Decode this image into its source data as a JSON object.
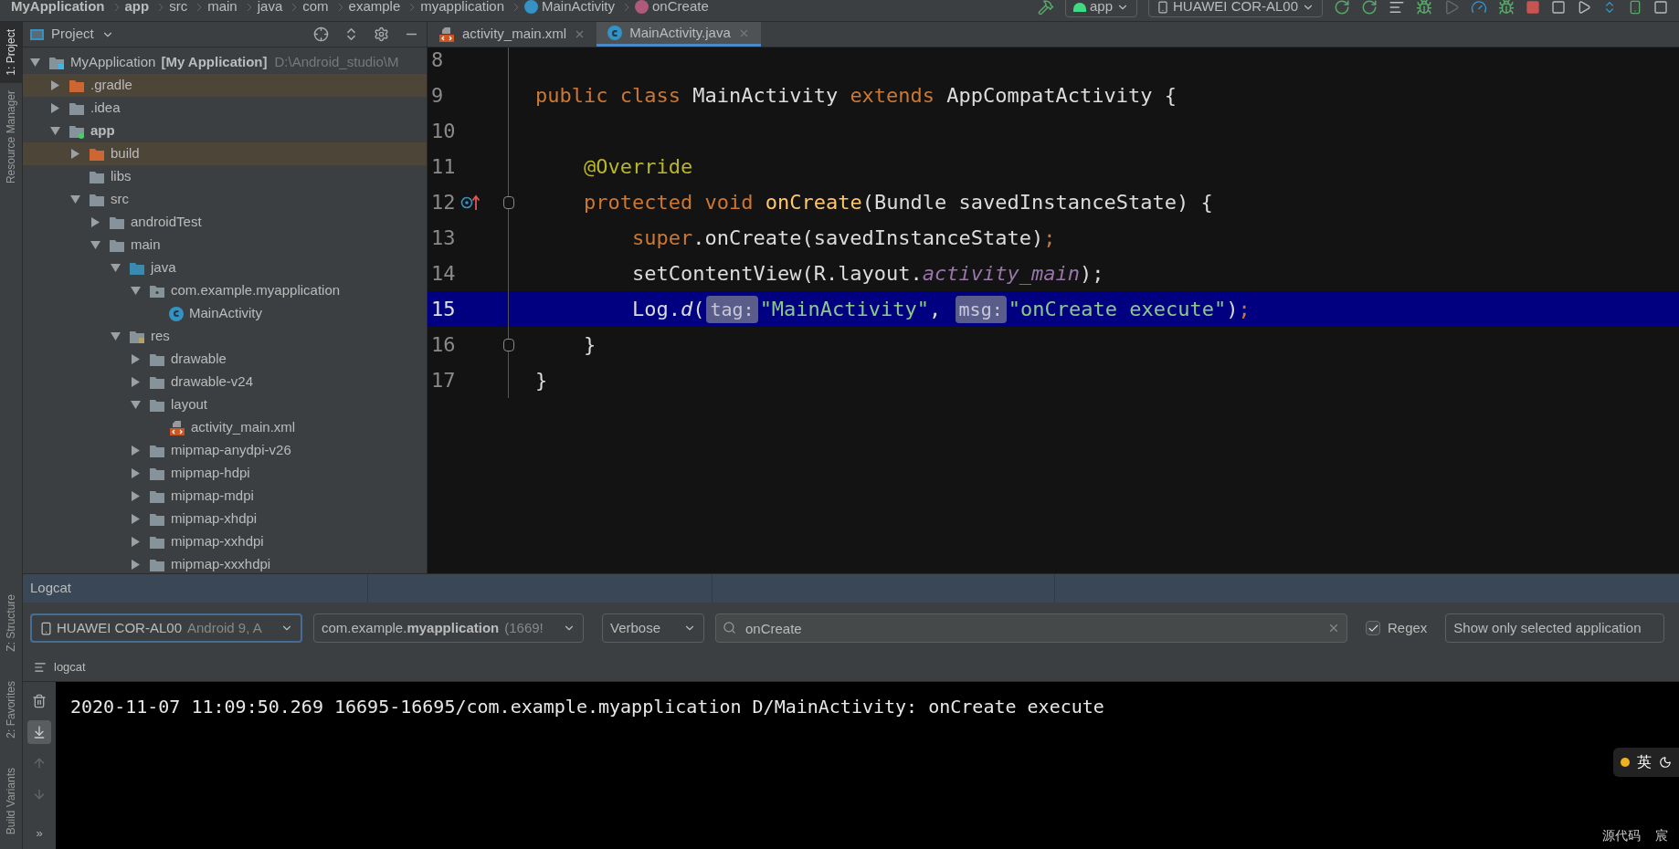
{
  "breadcrumbs": [
    {
      "label": "MyApplication",
      "kind": "project"
    },
    {
      "label": "app",
      "kind": "module"
    },
    {
      "label": "src",
      "kind": "dir"
    },
    {
      "label": "main",
      "kind": "dir"
    },
    {
      "label": "java",
      "kind": "dir"
    },
    {
      "label": "com",
      "kind": "dir"
    },
    {
      "label": "example",
      "kind": "dir"
    },
    {
      "label": "myapplication",
      "kind": "dir"
    },
    {
      "label": "MainActivity",
      "kind": "class"
    },
    {
      "label": "onCreate",
      "kind": "method"
    }
  ],
  "toolbar": {
    "run_config": "app",
    "device": "HUAWEI COR-AL00"
  },
  "side_tools_top": [
    {
      "label": "1: Project",
      "selected": true
    },
    {
      "label": "Resource Manager",
      "selected": false
    }
  ],
  "side_tools_bottom": [
    {
      "label": "Z: Structure",
      "selected": false
    },
    {
      "label": "2: Favorites",
      "selected": false
    },
    {
      "label": "Build Variants",
      "selected": false
    }
  ],
  "project_panel": {
    "title": "Project",
    "tree": [
      {
        "name": "MyApplication",
        "module_label": "[My Application]",
        "path": "D:\\Android_studio\\M",
        "kind": "project",
        "expanded": true,
        "children": [
          {
            "name": ".gradle",
            "kind": "excluded",
            "expanded": false
          },
          {
            "name": ".idea",
            "kind": "folder",
            "expanded": false
          },
          {
            "name": "app",
            "kind": "module",
            "expanded": true,
            "children": [
              {
                "name": "build",
                "kind": "excluded",
                "expanded": false
              },
              {
                "name": "libs",
                "kind": "folder"
              },
              {
                "name": "src",
                "kind": "folder",
                "expanded": true,
                "children": [
                  {
                    "name": "androidTest",
                    "kind": "folder",
                    "expanded": false
                  },
                  {
                    "name": "main",
                    "kind": "folder",
                    "expanded": true,
                    "children": [
                      {
                        "name": "java",
                        "kind": "source",
                        "expanded": true,
                        "children": [
                          {
                            "name": "com.example.myapplication",
                            "kind": "package",
                            "expanded": true,
                            "children": [
                              {
                                "name": "MainActivity",
                                "kind": "class"
                              }
                            ]
                          }
                        ]
                      },
                      {
                        "name": "res",
                        "kind": "resources",
                        "expanded": true,
                        "children": [
                          {
                            "name": "drawable",
                            "kind": "folder",
                            "expanded": false
                          },
                          {
                            "name": "drawable-v24",
                            "kind": "folder",
                            "expanded": false
                          },
                          {
                            "name": "layout",
                            "kind": "folder",
                            "expanded": true,
                            "children": [
                              {
                                "name": "activity_main.xml",
                                "kind": "xml"
                              }
                            ]
                          },
                          {
                            "name": "mipmap-anydpi-v26",
                            "kind": "folder",
                            "expanded": false
                          },
                          {
                            "name": "mipmap-hdpi",
                            "kind": "folder",
                            "expanded": false
                          },
                          {
                            "name": "mipmap-mdpi",
                            "kind": "folder",
                            "expanded": false
                          },
                          {
                            "name": "mipmap-xhdpi",
                            "kind": "folder",
                            "expanded": false
                          },
                          {
                            "name": "mipmap-xxhdpi",
                            "kind": "folder",
                            "expanded": false
                          },
                          {
                            "name": "mipmap-xxxhdpi",
                            "kind": "folder",
                            "expanded": false
                          }
                        ]
                      }
                    ]
                  }
                ]
              }
            ]
          }
        ]
      }
    ]
  },
  "editor": {
    "tabs": [
      {
        "label": "activity_main.xml",
        "kind": "xml",
        "selected": false
      },
      {
        "label": "MainActivity.java",
        "kind": "class",
        "selected": true
      }
    ],
    "lines": [
      {
        "number": "8",
        "highlighted": false
      },
      {
        "number": "9",
        "highlighted": false,
        "tokens": [
          {
            "text": "public class ",
            "kind": "keyword"
          },
          {
            "text": "MainActivity ",
            "kind": "plain"
          },
          {
            "text": "extends ",
            "kind": "keyword"
          },
          {
            "text": "AppCompatActivity {",
            "kind": "plain"
          }
        ]
      },
      {
        "number": "10",
        "highlighted": false
      },
      {
        "number": "11",
        "highlighted": false,
        "tokens": [
          {
            "text": "    @Override",
            "kind": "annotation"
          }
        ]
      },
      {
        "number": "12",
        "highlighted": false,
        "override_marker": true,
        "fold": true,
        "tokens": [
          {
            "text": "    protected void ",
            "kind": "keyword"
          },
          {
            "text": "onCreate",
            "kind": "method"
          },
          {
            "text": "(Bundle savedInstanceState) {",
            "kind": "plain"
          }
        ]
      },
      {
        "number": "13",
        "highlighted": false,
        "tokens": [
          {
            "text": "        super",
            "kind": "keyword"
          },
          {
            "text": ".onCreate(savedInstanceState)",
            "kind": "plain"
          },
          {
            "text": ";",
            "kind": "keyword"
          }
        ]
      },
      {
        "number": "14",
        "highlighted": false,
        "tokens": [
          {
            "text": "        setContentView(R.layout.",
            "kind": "plain"
          },
          {
            "text": "activity_main",
            "kind": "field"
          },
          {
            "text": ");",
            "kind": "plain"
          }
        ]
      },
      {
        "number": "15",
        "highlighted": true,
        "tokens": [
          {
            "text": "        Log.",
            "kind": "plain"
          },
          {
            "text": "d",
            "kind": "static"
          },
          {
            "text": "(",
            "kind": "plain"
          },
          {
            "text": "tag:",
            "kind": "hint"
          },
          {
            "text": "\"MainActivity\"",
            "kind": "string"
          },
          {
            "text": ", ",
            "kind": "plain"
          },
          {
            "text": "msg:",
            "kind": "hint"
          },
          {
            "text": "\"onCreate execute\"",
            "kind": "string"
          },
          {
            "text": ")",
            "kind": "plain"
          },
          {
            "text": ";",
            "kind": "keyword"
          }
        ]
      },
      {
        "number": "16",
        "highlighted": false,
        "fold": true,
        "tokens": [
          {
            "text": "    }",
            "kind": "plain"
          }
        ]
      },
      {
        "number": "17",
        "highlighted": false,
        "tokens": [
          {
            "text": "}",
            "kind": "plain"
          }
        ]
      }
    ]
  },
  "logcat": {
    "title": "Logcat",
    "device": "HUAWEI COR-AL00",
    "device_detail": "Android 9, A",
    "process": "com.example.**myapplication**",
    "process_detail": "(1669!",
    "level": "Verbose",
    "search": "onCreate",
    "regex": {
      "label": "Regex",
      "checked": true
    },
    "filter": "Show only selected application",
    "tab": "logcat",
    "side_buttons": [
      {
        "kind": "clear",
        "selected": false
      },
      {
        "kind": "scroll_end",
        "selected": true
      },
      {
        "kind": "up",
        "selected": false
      },
      {
        "kind": "down",
        "selected": false
      },
      {
        "kind": "more",
        "selected": false,
        "label": "»"
      }
    ],
    "lines": [
      "2020-11-07 11:09:50.269 16695-16695/com.example.myapplication D/MainActivity: onCreate execute"
    ]
  },
  "ime": {
    "mode": "英",
    "status": "源代码",
    "extra": "宸"
  }
}
